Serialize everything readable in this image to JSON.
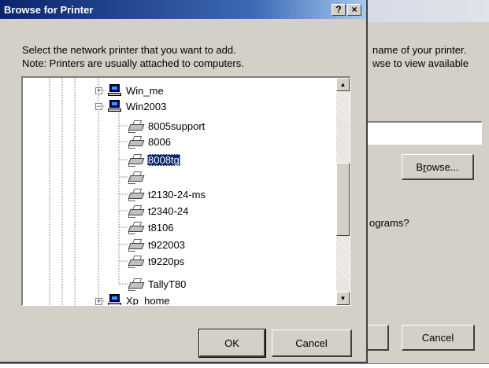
{
  "background_window": {
    "text_line1": "name of your printer.",
    "text_line2": "wse to view available",
    "browse_label": "Browse...",
    "browse_access_key": "r",
    "question_text": "ograms?",
    "cancel_label": "Cancel"
  },
  "dialog": {
    "title": "Browse for Printer",
    "help_button": "?",
    "close_button": "×",
    "description_line1": "Select the network printer that you want to add.",
    "description_line2": "Note: Printers are usually attached to computers.",
    "ok_label": "OK",
    "cancel_label": "Cancel"
  },
  "tree": {
    "computers": [
      {
        "label": "Win_me",
        "expander": "+"
      },
      {
        "label": "Win2003",
        "expander": "−"
      },
      {
        "label": "Xp_home",
        "expander": "+"
      }
    ],
    "printers": [
      {
        "label": "8005support"
      },
      {
        "label": "8006"
      },
      {
        "label": "8008tg",
        "selected": true
      },
      {
        "label": ""
      },
      {
        "label": "t2130-24-ms"
      },
      {
        "label": "t2340-24"
      },
      {
        "label": "t8106"
      },
      {
        "label": "t922003"
      },
      {
        "label": "t9220ps"
      },
      {
        "label": "TallyT80"
      }
    ]
  },
  "scrollbar": {
    "up_glyph": "▲",
    "down_glyph": "▼"
  },
  "colors": {
    "titlebar_start": "#0a246a",
    "titlebar_end": "#a6caf0",
    "selection": "#0a246a",
    "face": "#d4d0c8"
  }
}
